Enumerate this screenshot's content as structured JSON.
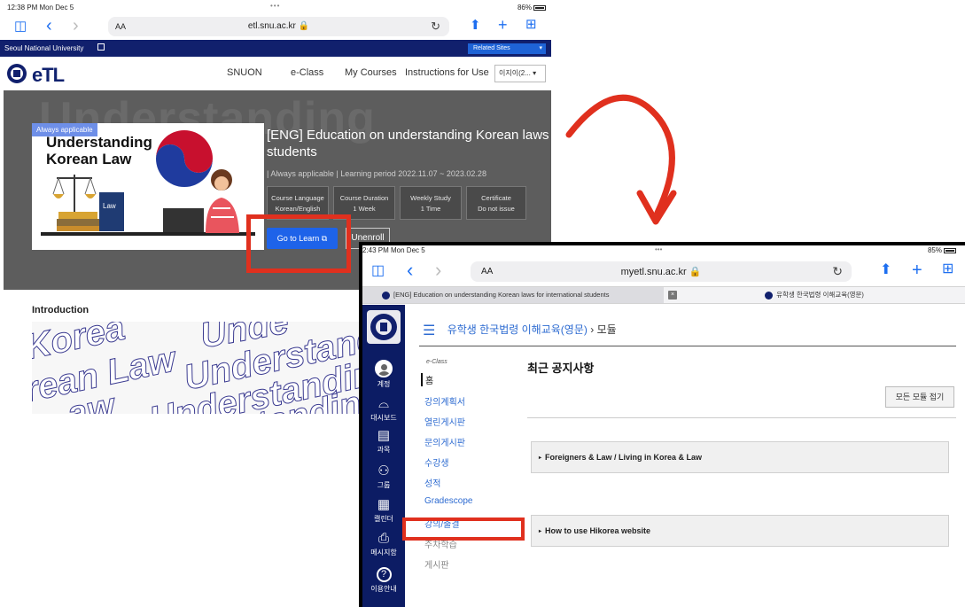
{
  "shot1": {
    "status": {
      "time": "12:38 PM  Mon Dec 5",
      "dots": "•••",
      "battery": "86%"
    },
    "safari": {
      "aa": "AA",
      "url": "etl.snu.ac.kr 🔒",
      "reload": "↻",
      "sidebar_icon": "◫",
      "back_icon": "‹",
      "forward_icon": "›",
      "share_icon": "⬆",
      "plus_icon": "+",
      "tabs_icon": "⊞"
    },
    "univ_bar": {
      "name": "Seoul National University",
      "related": "Related Sites"
    },
    "nav": {
      "brand": "eTL",
      "links": [
        "SNUON",
        "e-Class",
        "My Courses",
        "Instructions for Use"
      ],
      "lang": "이지이(2... ▾"
    },
    "hero": {
      "bg_text": "Understanding",
      "badge": "Always applicable",
      "card_title_1": "Understanding",
      "card_title_2": "Korean Law",
      "card_book_label": "Law",
      "course_title_1": "[ENG] Education on understanding Korean laws fo",
      "course_title_2": "students",
      "meta": "| Always applicable | Learning period 2022.11.07 ~ 2023.02.28",
      "info": [
        {
          "label": "Course Language",
          "value": "Korean/English"
        },
        {
          "label": "Course Duration",
          "value": "1 Week"
        },
        {
          "label": "Weekly Study",
          "value": "1 Time"
        },
        {
          "label": "Certificate",
          "value": "Do not issue"
        }
      ],
      "go_learn": "Go to Learn ⧉",
      "unenroll": "Unenroll"
    },
    "intro": {
      "title": "Introduction",
      "banner_words": [
        "Korea",
        "Unde",
        "rean Law",
        "Understandi",
        "Understanding K",
        "aw",
        "standing"
      ]
    }
  },
  "shot2": {
    "status": {
      "time": "2:43 PM  Mon Dec 5",
      "dots": "•••",
      "battery": "85%"
    },
    "safari": {
      "aa": "AA",
      "url": "myetl.snu.ac.kr 🔒",
      "reload": "↻",
      "sidebar_icon": "◫",
      "back_icon": "‹",
      "forward_icon": "›",
      "share_icon": "⬆",
      "plus_icon": "+",
      "tabs_icon": "⊞"
    },
    "tabs": [
      "[ENG] Education on understanding Korean laws for international students",
      "유학생 한국법령 이해교육(영문)"
    ],
    "tab_close": "×",
    "sidebar": [
      {
        "label": "계정",
        "icon": "avatar"
      },
      {
        "label": "대시보드",
        "icon": "⌓"
      },
      {
        "label": "과목",
        "icon": "▤"
      },
      {
        "label": "그룹",
        "icon": "⚇"
      },
      {
        "label": "캘린더",
        "icon": "▦"
      },
      {
        "label": "메시지함",
        "icon": "⎙"
      },
      {
        "label": "이용안내",
        "icon": "?"
      }
    ],
    "breadcrumb": {
      "menu_icon": "☰",
      "course": "유학생 한국법령 이해교육(영문)",
      "sep": "›",
      "current": "모듈"
    },
    "course_nav": {
      "label": "e-Class",
      "items": [
        "홈",
        "강의계획서",
        "열린게시판",
        "문의게시판",
        "수강생",
        "성적",
        "Gradescope",
        "강의/출결",
        "주차학습",
        "게시판"
      ]
    },
    "notice_title": "최근 공지사항",
    "collapse_button": "모든 모듈 접기",
    "modules": [
      "Foreigners & Law / Living in Korea & Law",
      "How to use Hikorea website"
    ],
    "caret": "▸"
  },
  "colors": {
    "snu_navy": "#11206d",
    "link_blue": "#2d6bd1",
    "button_blue": "#1e63e9",
    "highlight_red": "#e0301e"
  }
}
